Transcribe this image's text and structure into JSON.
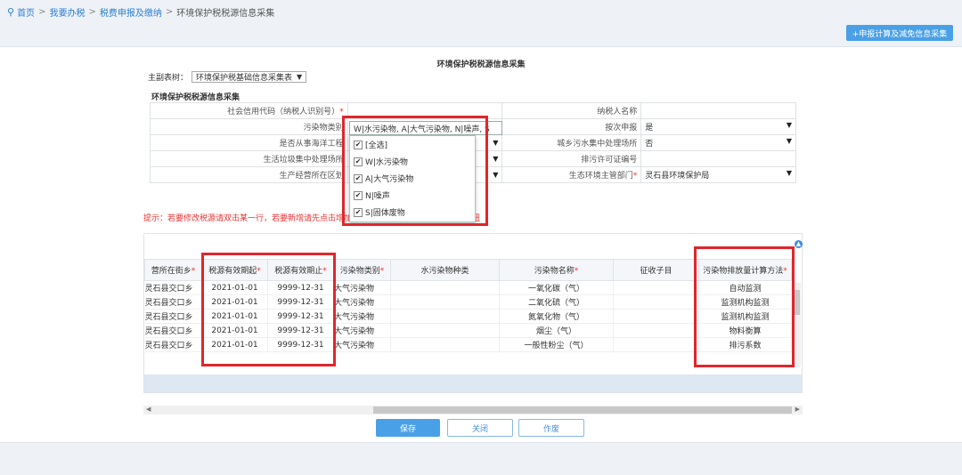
{
  "breadcrumb": {
    "home": "首页",
    "level2": "我要办税",
    "level3": "税费申报及缴纳",
    "current": "环境保护税税源信息采集"
  },
  "top_button": "+申报计算及减免信息采集",
  "form": {
    "title": "环境保护税税源信息采集",
    "main_table_label": "主副表树：",
    "main_table_value": "环境保护税基础信息采集表",
    "section_title": "环境保护税税源信息采集",
    "rows": [
      {
        "l1": "社会信用代码（纳税人识别号）",
        "v1": "",
        "l2": "纳税人名称",
        "v2": ""
      },
      {
        "l1": "污染物类别",
        "v1": "W|水污染物, A|大气污染物, N|噪声, S",
        "l2": "按次申报",
        "v2": "是"
      },
      {
        "l1": "是否从事海洋工程",
        "v1": "",
        "l2": "城乡污水集中处理场所",
        "v2": "否"
      },
      {
        "l1": "生活垃圾集中处理场所",
        "v1": "",
        "l2": "排污许可证编号",
        "v2": ""
      },
      {
        "l1": "生产经营所在区划",
        "v1": "",
        "l2": "生态环境主管部门",
        "v2": "灵石县环境保护局"
      }
    ]
  },
  "dropdown_options": [
    "[全选]",
    "W|水污染物",
    "A|大气污染物",
    "N|噪声",
    "S|固体废物"
  ],
  "tip": "提示：若要修改税源请双击某一行，若要新增请先点击增加，修改完毕后，请点击【确定】按钮",
  "grid": {
    "headers": [
      "营所在街乡",
      "税源有效期起",
      "税源有效期止",
      "污染物类别",
      "水污染物种类",
      "污染物名称",
      "征收子目",
      "污染物排放量计算方法"
    ],
    "rows": [
      [
        "灵石县交口乡",
        "2021-01-01",
        "9999-12-31",
        "大气污染物",
        "",
        "一氧化碳（气）",
        "",
        "自动监测"
      ],
      [
        "灵石县交口乡",
        "2021-01-01",
        "9999-12-31",
        "大气污染物",
        "",
        "二氧化硫（气）",
        "",
        "监测机构监测"
      ],
      [
        "灵石县交口乡",
        "2021-01-01",
        "9999-12-31",
        "大气污染物",
        "",
        "氮氧化物（气）",
        "",
        "监测机构监测"
      ],
      [
        "灵石县交口乡",
        "2021-01-01",
        "9999-12-31",
        "大气污染物",
        "",
        "烟尘（气）",
        "",
        "物料衡算"
      ],
      [
        "灵石县交口乡",
        "2021-01-01",
        "9999-12-31",
        "大气污染物",
        "",
        "一般性粉尘（气）",
        "",
        "排污系数"
      ]
    ]
  },
  "buttons": {
    "save": "保存",
    "close": "关闭",
    "void": "作废"
  },
  "colors": {
    "accent": "#4aa0e6",
    "highlight": "#e0262c",
    "required": "#e33333"
  }
}
